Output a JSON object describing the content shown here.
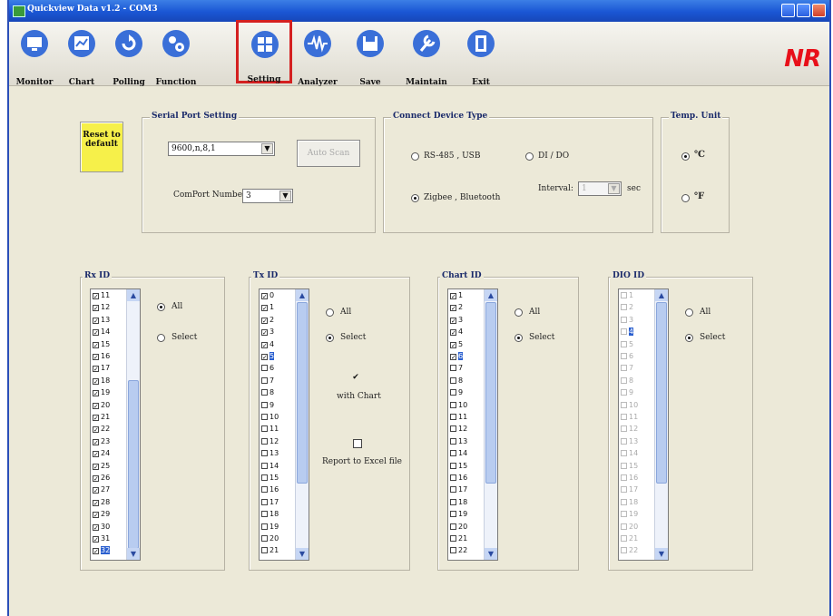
{
  "window": {
    "title": "Quickview Data v1.2 - COM3"
  },
  "toolbar": {
    "items": [
      {
        "label": "Monitor",
        "icon": "monitor-icon",
        "color": "#3a6fd8"
      },
      {
        "label": "Chart",
        "icon": "chart-icon",
        "color": "#3a6fd8"
      },
      {
        "label": "Polling",
        "icon": "polling-icon",
        "color": "#3a6fd8"
      },
      {
        "label": "Function",
        "icon": "gears-icon",
        "color": "#3a6fd8"
      },
      {
        "label": "Setting",
        "icon": "setting-icon",
        "color": "#3a6fd8"
      },
      {
        "label": "Analyzer",
        "icon": "analyzer-icon",
        "color": "#3a6fd8"
      },
      {
        "label": "Save",
        "icon": "save-icon",
        "color": "#3a6fd8"
      },
      {
        "label": "Maintain",
        "icon": "maintain-icon",
        "color": "#3a6fd8"
      },
      {
        "label": "Exit",
        "icon": "exit-icon",
        "color": "#3a6fd8"
      }
    ],
    "selected": "Setting",
    "logo": "NR"
  },
  "reset_button": "Reset to default",
  "serial": {
    "title": "Serial Port Setting",
    "baud": "9600,n,8,1",
    "auto_scan": "Auto Scan",
    "comport_label": "ComPort Number:",
    "comport_value": "3"
  },
  "device": {
    "title": "Connect Device Type",
    "rs485": "RS-485 , USB",
    "dido": "DI / DO",
    "zigbee": "Zigbee , Bluetooth",
    "interval_label": "Interval:",
    "interval_value": "1",
    "interval_unit": "sec"
  },
  "temp": {
    "title": "Temp. Unit",
    "c": "℃",
    "f": "℉"
  },
  "rx": {
    "title": "Rx ID",
    "all": "All",
    "select": "Select",
    "items": [
      "11",
      "12",
      "13",
      "14",
      "15",
      "16",
      "17",
      "18",
      "19",
      "20",
      "21",
      "22",
      "23",
      "24",
      "25",
      "26",
      "27",
      "28",
      "29",
      "30",
      "31",
      "32"
    ]
  },
  "tx": {
    "title": "Tx ID",
    "all": "All",
    "select": "Select",
    "with_chart": "with Chart",
    "report": "Report to Excel file",
    "items": [
      "0",
      "1",
      "2",
      "3",
      "4",
      "5",
      "6",
      "7",
      "8",
      "9",
      "10",
      "11",
      "12",
      "13",
      "14",
      "15",
      "16",
      "17",
      "18",
      "19",
      "20",
      "21"
    ]
  },
  "chart": {
    "title": "Chart ID",
    "all": "All",
    "select": "Select",
    "items": [
      "1",
      "2",
      "3",
      "4",
      "5",
      "6",
      "7",
      "8",
      "9",
      "10",
      "11",
      "12",
      "13",
      "14",
      "15",
      "16",
      "17",
      "18",
      "19",
      "20",
      "21",
      "22"
    ]
  },
  "dio": {
    "title": "DIO ID",
    "all": "All",
    "select": "Select",
    "items": [
      "1",
      "2",
      "3",
      "4",
      "5",
      "6",
      "7",
      "8",
      "9",
      "10",
      "11",
      "12",
      "13",
      "14",
      "15",
      "16",
      "17",
      "18",
      "19",
      "20",
      "21",
      "22"
    ]
  }
}
